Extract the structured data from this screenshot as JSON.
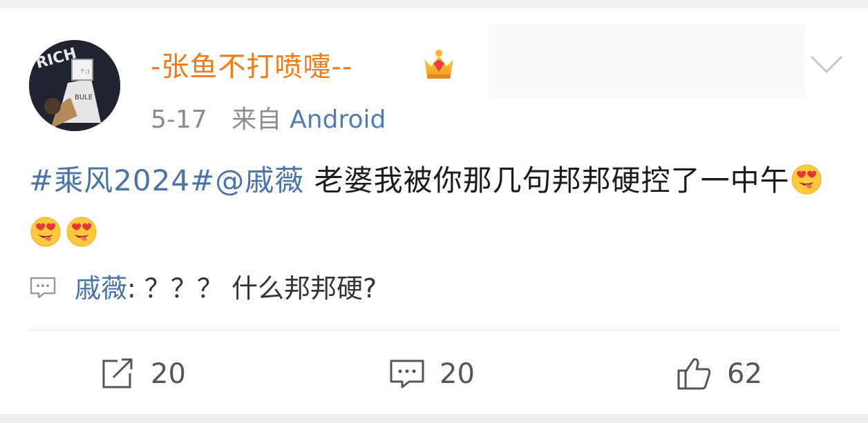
{
  "post": {
    "username": "-张鱼不打喷嚏--",
    "date": "5-17",
    "from_prefix": "来自",
    "source": "Android",
    "topic": "#乘风2024#",
    "mention": "@戚薇",
    "text_line": "老婆我被你那几句邦邦硬控了一中午",
    "emoji_name": "heart-eyes-tongue-emoji",
    "avatar_text": "RICH",
    "shirt_text": "BULE"
  },
  "reply": {
    "user": "戚薇",
    "colon": ":",
    "text": "？？？ 什么邦邦硬?"
  },
  "actions": {
    "repost_count": "20",
    "comment_count": "20",
    "like_count": "62"
  },
  "colors": {
    "username": "#f07a18",
    "link": "#4a73a6",
    "meta": "#8c8c8c"
  }
}
